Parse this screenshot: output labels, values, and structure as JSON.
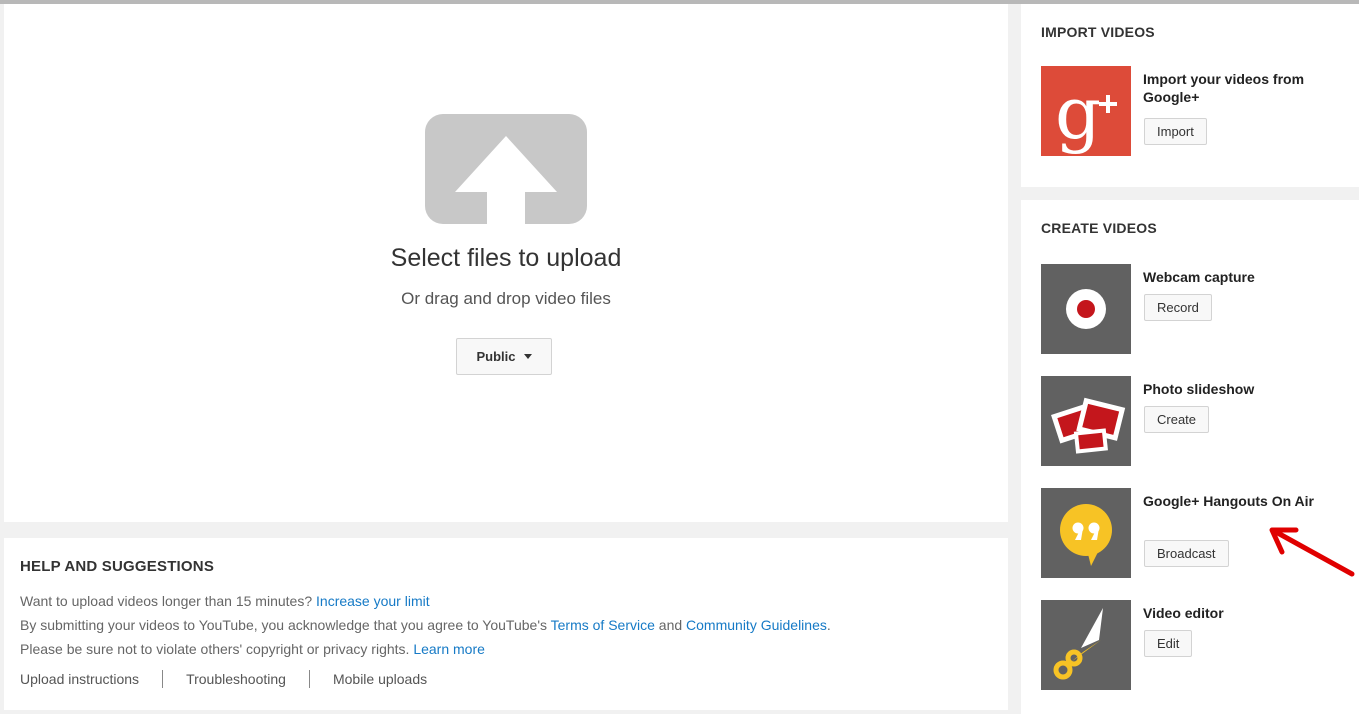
{
  "upload": {
    "title": "Select files to upload",
    "subtitle": "Or drag and drop video files",
    "privacy_label": "Public",
    "icon": "upload-arrow-icon"
  },
  "help": {
    "title": "HELP AND SUGGESTIONS",
    "line1_text": "Want to upload videos longer than 15 minutes?",
    "line1_link": "Increase your limit",
    "line2_text_a": "By submitting your videos to YouTube, you acknowledge that you agree to YouTube's",
    "line2_link_a": "Terms of Service",
    "line2_text_b": "and",
    "line2_link_b": "Community Guidelines",
    "line2_period": ".",
    "line3_text": "Please be sure not to violate others' copyright or privacy rights.",
    "line3_link": "Learn more",
    "links": [
      "Upload instructions",
      "Troubleshooting",
      "Mobile uploads"
    ]
  },
  "import": {
    "title": "IMPORT VIDEOS",
    "item_title": "Import your videos from Google+",
    "button": "Import",
    "icon": "google-plus-icon"
  },
  "create": {
    "title": "CREATE VIDEOS",
    "items": [
      {
        "title": "Webcam capture",
        "button": "Record",
        "icon": "webcam-record-icon"
      },
      {
        "title": "Photo slideshow",
        "button": "Create",
        "icon": "photo-slideshow-icon"
      },
      {
        "title": "Google+ Hangouts On Air",
        "button": "Broadcast",
        "icon": "hangouts-icon"
      },
      {
        "title": "Video editor",
        "button": "Edit",
        "icon": "scissors-icon"
      }
    ]
  },
  "colors": {
    "link": "#167ac6",
    "google_plus_red": "#dd4b39",
    "hangouts_yellow": "#f7c325",
    "annotation_arrow": "#e00000"
  }
}
